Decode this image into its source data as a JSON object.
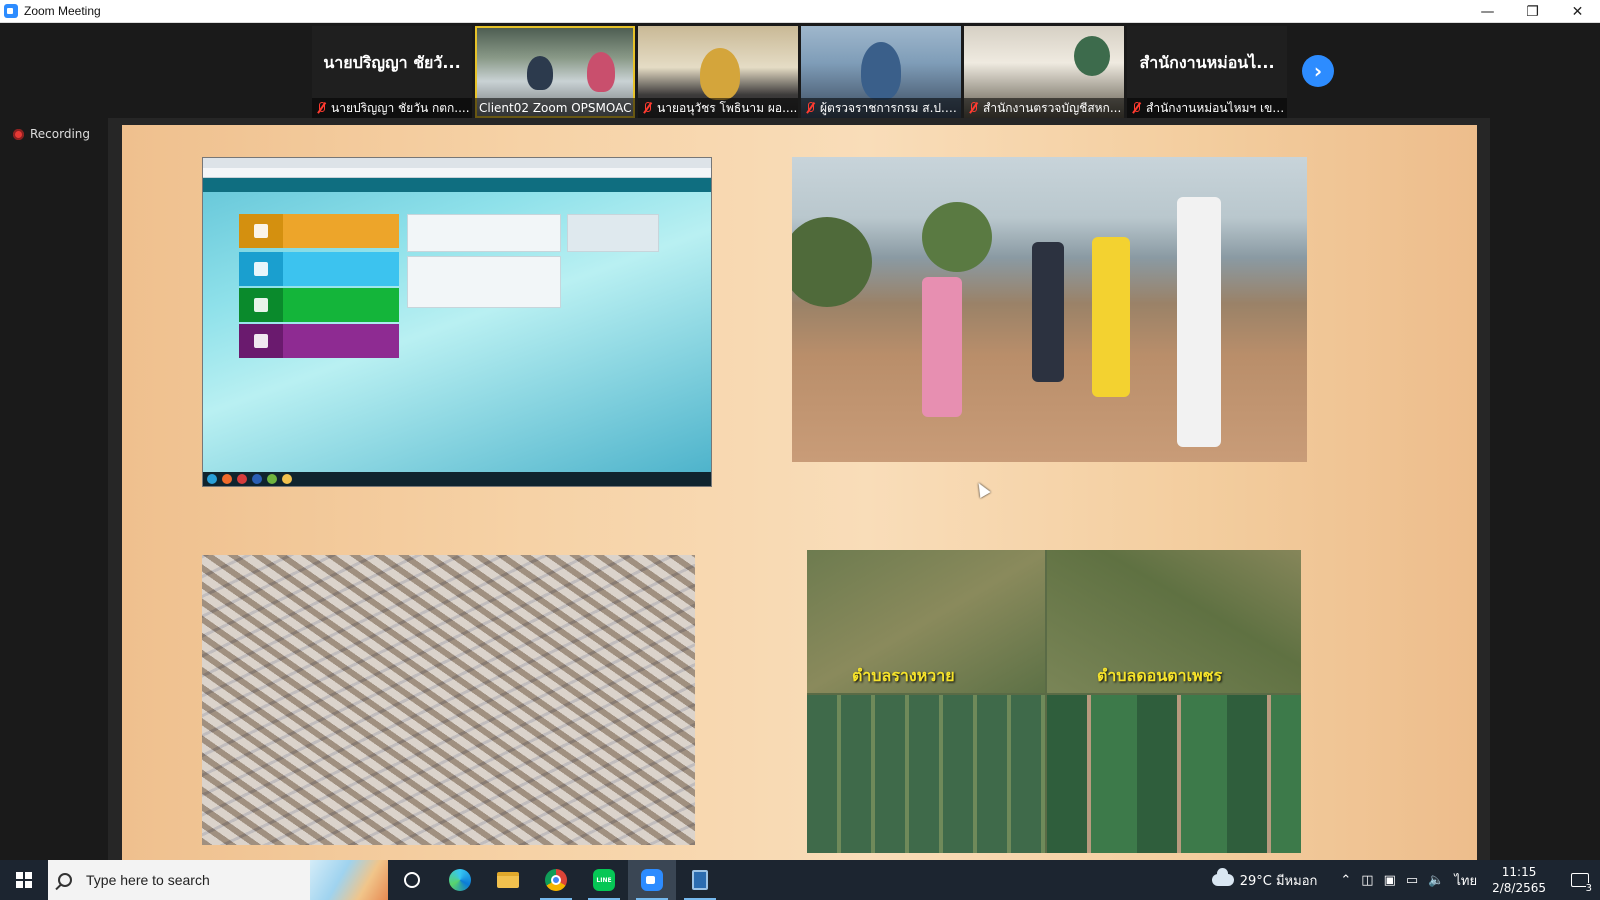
{
  "window": {
    "title": "Zoom Meeting",
    "controls": {
      "minimize": "—",
      "restore": "❐",
      "close": "✕"
    }
  },
  "participants": [
    {
      "big_name": "นายปริญญา ชัยวั...",
      "caption": "นายปริญญา ชัยวัน กตก....",
      "muted": true,
      "video": false
    },
    {
      "big_name": "",
      "caption": "Client02 Zoom OPSMOAC",
      "muted": false,
      "video": true,
      "active": true
    },
    {
      "big_name": "",
      "caption": "นายอนุวัชร โพธินาม ผอ....",
      "muted": true,
      "video": true
    },
    {
      "big_name": "",
      "caption": "ผู้ตรวจราชการกรม ส.ป.ก....",
      "muted": true,
      "video": true
    },
    {
      "big_name": "",
      "caption": "สำนักงานตรวจบัญชีสหก...",
      "muted": true,
      "video": true
    },
    {
      "big_name": "สำนักงานหม่อนไ...",
      "caption": "สำนักงานหม่อนไหมฯ เขต...",
      "muted": true,
      "video": false
    }
  ],
  "recording_label": "Recording",
  "slide": {
    "map_labels": [
      "ตำบลรางหวาย",
      "ตำบลดอนตาเพชร"
    ]
  },
  "taskbar": {
    "search_placeholder": "Type here to search",
    "weather": "29°C มีหมอก",
    "language": "ไทย",
    "time": "11:15",
    "date": "2/8/2565",
    "notification_count": "3"
  }
}
